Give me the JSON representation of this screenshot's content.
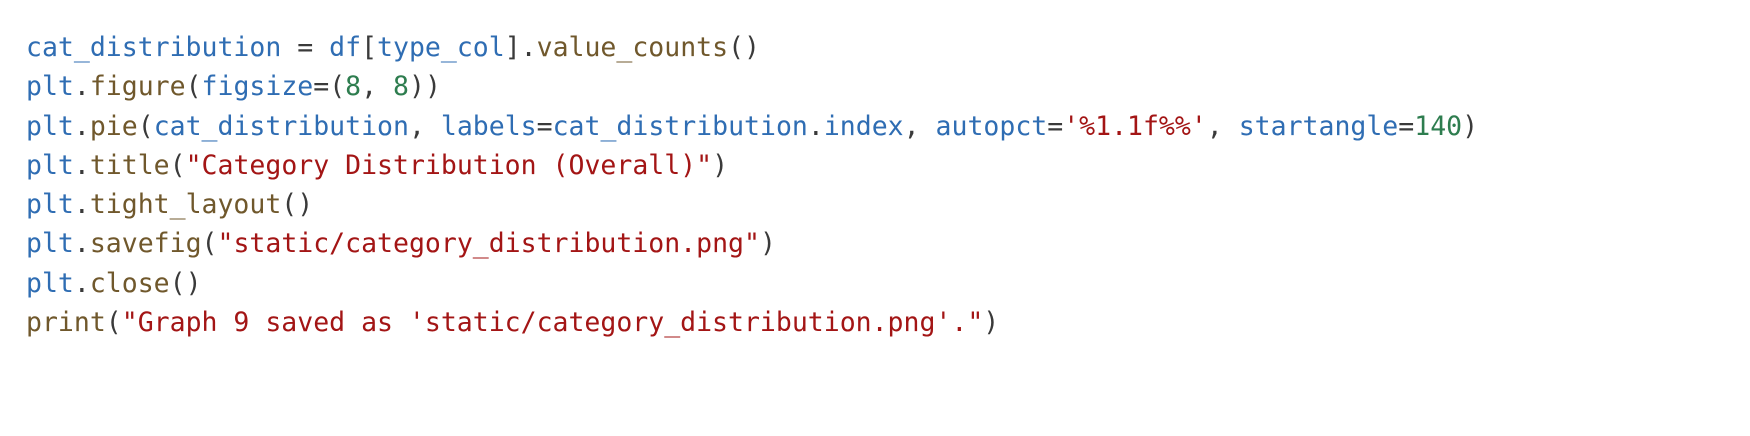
{
  "code": {
    "lines": [
      [
        {
          "t": "cat_distribution",
          "k": "var",
          "n": "identifier"
        },
        {
          "t": " = ",
          "k": "pun",
          "n": "operator"
        },
        {
          "t": "df",
          "k": "var",
          "n": "identifier"
        },
        {
          "t": "[",
          "k": "pun",
          "n": "bracket"
        },
        {
          "t": "type_col",
          "k": "var",
          "n": "identifier"
        },
        {
          "t": "].",
          "k": "pun",
          "n": "bracket"
        },
        {
          "t": "value_counts",
          "k": "fn",
          "n": "function-name"
        },
        {
          "t": "()",
          "k": "pun",
          "n": "paren"
        }
      ],
      [
        {
          "t": "plt",
          "k": "var",
          "n": "identifier"
        },
        {
          "t": ".",
          "k": "pun",
          "n": "punctuation"
        },
        {
          "t": "figure",
          "k": "fn",
          "n": "function-name"
        },
        {
          "t": "(",
          "k": "pun",
          "n": "paren"
        },
        {
          "t": "figsize",
          "k": "var",
          "n": "keyword-arg"
        },
        {
          "t": "=(",
          "k": "pun",
          "n": "operator"
        },
        {
          "t": "8",
          "k": "num",
          "n": "number-literal"
        },
        {
          "t": ", ",
          "k": "pun",
          "n": "punctuation"
        },
        {
          "t": "8",
          "k": "num",
          "n": "number-literal"
        },
        {
          "t": "))",
          "k": "pun",
          "n": "paren"
        }
      ],
      [
        {
          "t": "plt",
          "k": "var",
          "n": "identifier"
        },
        {
          "t": ".",
          "k": "pun",
          "n": "punctuation"
        },
        {
          "t": "pie",
          "k": "fn",
          "n": "function-name"
        },
        {
          "t": "(",
          "k": "pun",
          "n": "paren"
        },
        {
          "t": "cat_distribution",
          "k": "var",
          "n": "identifier"
        },
        {
          "t": ", ",
          "k": "pun",
          "n": "punctuation"
        },
        {
          "t": "labels",
          "k": "var",
          "n": "keyword-arg"
        },
        {
          "t": "=",
          "k": "pun",
          "n": "operator"
        },
        {
          "t": "cat_distribution",
          "k": "var",
          "n": "identifier"
        },
        {
          "t": ".",
          "k": "pun",
          "n": "punctuation"
        },
        {
          "t": "index",
          "k": "var",
          "n": "identifier"
        },
        {
          "t": ", ",
          "k": "pun",
          "n": "punctuation"
        },
        {
          "t": "autopct",
          "k": "var",
          "n": "keyword-arg"
        },
        {
          "t": "=",
          "k": "pun",
          "n": "operator"
        },
        {
          "t": "'%1.1f%%'",
          "k": "str",
          "n": "string-literal"
        },
        {
          "t": ", ",
          "k": "pun",
          "n": "punctuation"
        },
        {
          "t": "startangle",
          "k": "var",
          "n": "keyword-arg"
        },
        {
          "t": "=",
          "k": "pun",
          "n": "operator"
        },
        {
          "t": "140",
          "k": "num",
          "n": "number-literal"
        },
        {
          "t": ")",
          "k": "pun",
          "n": "paren"
        }
      ],
      [
        {
          "t": "plt",
          "k": "var",
          "n": "identifier"
        },
        {
          "t": ".",
          "k": "pun",
          "n": "punctuation"
        },
        {
          "t": "title",
          "k": "fn",
          "n": "function-name"
        },
        {
          "t": "(",
          "k": "pun",
          "n": "paren"
        },
        {
          "t": "\"Category Distribution (Overall)\"",
          "k": "str",
          "n": "string-literal"
        },
        {
          "t": ")",
          "k": "pun",
          "n": "paren"
        }
      ],
      [
        {
          "t": "plt",
          "k": "var",
          "n": "identifier"
        },
        {
          "t": ".",
          "k": "pun",
          "n": "punctuation"
        },
        {
          "t": "tight_layout",
          "k": "fn",
          "n": "function-name"
        },
        {
          "t": "()",
          "k": "pun",
          "n": "paren"
        }
      ],
      [
        {
          "t": "plt",
          "k": "var",
          "n": "identifier"
        },
        {
          "t": ".",
          "k": "pun",
          "n": "punctuation"
        },
        {
          "t": "savefig",
          "k": "fn",
          "n": "function-name"
        },
        {
          "t": "(",
          "k": "pun",
          "n": "paren"
        },
        {
          "t": "\"static/category_distribution.png\"",
          "k": "str",
          "n": "string-literal"
        },
        {
          "t": ")",
          "k": "pun",
          "n": "paren"
        }
      ],
      [
        {
          "t": "plt",
          "k": "var",
          "n": "identifier"
        },
        {
          "t": ".",
          "k": "pun",
          "n": "punctuation"
        },
        {
          "t": "close",
          "k": "fn",
          "n": "function-name"
        },
        {
          "t": "()",
          "k": "pun",
          "n": "paren"
        }
      ],
      [
        {
          "t": "print",
          "k": "fn",
          "n": "function-name"
        },
        {
          "t": "(",
          "k": "pun",
          "n": "paren"
        },
        {
          "t": "\"Graph 9 saved as 'static/category_distribution.png'.\"",
          "k": "str",
          "n": "string-literal"
        },
        {
          "t": ")",
          "k": "pun",
          "n": "paren"
        }
      ]
    ]
  },
  "colors": {
    "background": "#ffffff",
    "identifier": "#2f6db3",
    "function": "#70582c",
    "string": "#a31515",
    "number": "#2e7d4f",
    "punctuation": "#3a3a3a"
  }
}
